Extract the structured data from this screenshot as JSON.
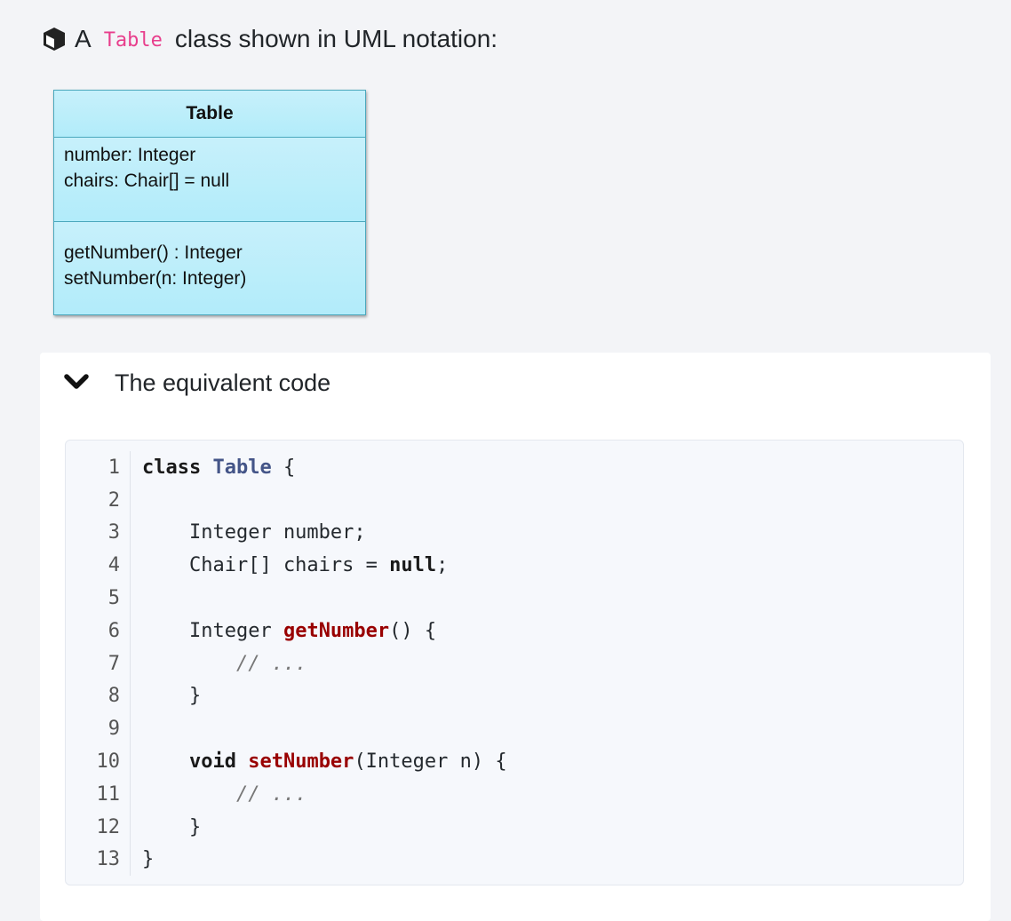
{
  "heading": {
    "prefix": "A",
    "code": "Table",
    "suffix": "class shown in UML notation:",
    "icon": "cube-icon"
  },
  "uml": {
    "class_name": "Table",
    "attributes": [
      "number: Integer",
      "chairs: Chair[] = null"
    ],
    "operations": [
      "getNumber() : Integer",
      "setNumber(n: Integer)"
    ],
    "colors": {
      "fill": "#b8eefb",
      "border": "#4aa8bd"
    }
  },
  "panel": {
    "title": "The equivalent code",
    "expanded": true,
    "icon": "chevron-down-icon"
  },
  "code": {
    "language": "java",
    "lines": [
      {
        "n": "1",
        "tokens": [
          [
            "kw",
            "class"
          ],
          [
            "t",
            " "
          ],
          [
            "cls",
            "Table"
          ],
          [
            "t",
            " {"
          ]
        ]
      },
      {
        "n": "2",
        "tokens": []
      },
      {
        "n": "3",
        "tokens": [
          [
            "t",
            "    Integer number;"
          ]
        ]
      },
      {
        "n": "4",
        "tokens": [
          [
            "t",
            "    Chair[] chairs = "
          ],
          [
            "kw",
            "null"
          ],
          [
            "t",
            ";"
          ]
        ]
      },
      {
        "n": "5",
        "tokens": []
      },
      {
        "n": "6",
        "tokens": [
          [
            "t",
            "    Integer "
          ],
          [
            "fn",
            "getNumber"
          ],
          [
            "t",
            "() {"
          ]
        ]
      },
      {
        "n": "7",
        "tokens": [
          [
            "t",
            "        "
          ],
          [
            "cm",
            "// ..."
          ]
        ]
      },
      {
        "n": "8",
        "tokens": [
          [
            "t",
            "    }"
          ]
        ]
      },
      {
        "n": "9",
        "tokens": []
      },
      {
        "n": "10",
        "tokens": [
          [
            "t",
            "    "
          ],
          [
            "kw",
            "void"
          ],
          [
            "t",
            " "
          ],
          [
            "fn",
            "setNumber"
          ],
          [
            "t",
            "(Integer n) {"
          ]
        ]
      },
      {
        "n": "11",
        "tokens": [
          [
            "t",
            "        "
          ],
          [
            "cm",
            "// ..."
          ]
        ]
      },
      {
        "n": "12",
        "tokens": [
          [
            "t",
            "    }"
          ]
        ]
      },
      {
        "n": "13",
        "tokens": [
          [
            "t",
            "}"
          ]
        ]
      }
    ]
  }
}
